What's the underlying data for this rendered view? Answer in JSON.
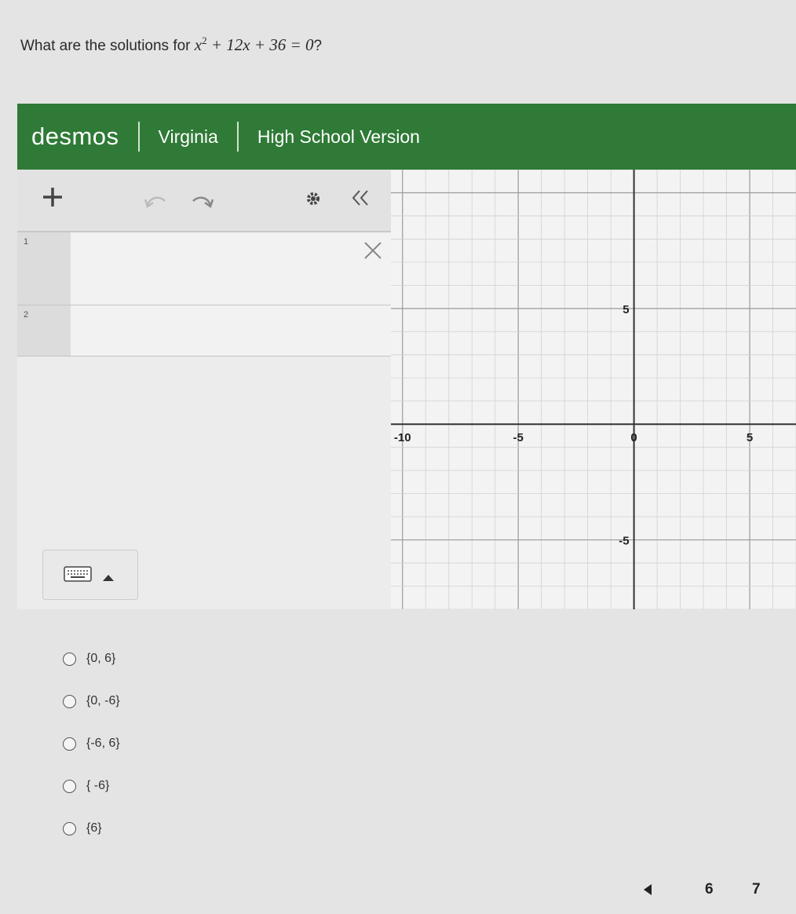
{
  "question": {
    "prefix": "What are the solutions for",
    "equation_x": "x",
    "equation_exp": "2",
    "equation_rest": " + 12x + 36 = 0",
    "suffix": "?"
  },
  "calculator": {
    "brand": "desmos",
    "region": "Virginia",
    "version": "High School Version",
    "toolbar_icons": [
      "plus-icon",
      "undo-icon",
      "redo-icon",
      "gear-icon",
      "collapse-icon"
    ],
    "expressions": [
      {
        "number": "1",
        "value": ""
      },
      {
        "number": "2",
        "value": ""
      }
    ],
    "keyboard_icon": "keyboard-icon"
  },
  "graph": {
    "x_range": [
      -10.5,
      7
    ],
    "y_range": [
      -8,
      11
    ],
    "grid_step": 1,
    "major_step": 5,
    "x_tick_labels": [
      "-10",
      "-5",
      "0",
      "5"
    ],
    "y_tick_labels": [
      "5",
      "-5"
    ]
  },
  "answers": [
    {
      "label": "{0, 6}"
    },
    {
      "label": "{0, -6}"
    },
    {
      "label": "{-6, 6}"
    },
    {
      "label": "{ -6}"
    },
    {
      "label": "{6}"
    }
  ],
  "pagination": {
    "prev_icon": "triangle-left-icon",
    "pages": [
      "6",
      "7"
    ]
  }
}
